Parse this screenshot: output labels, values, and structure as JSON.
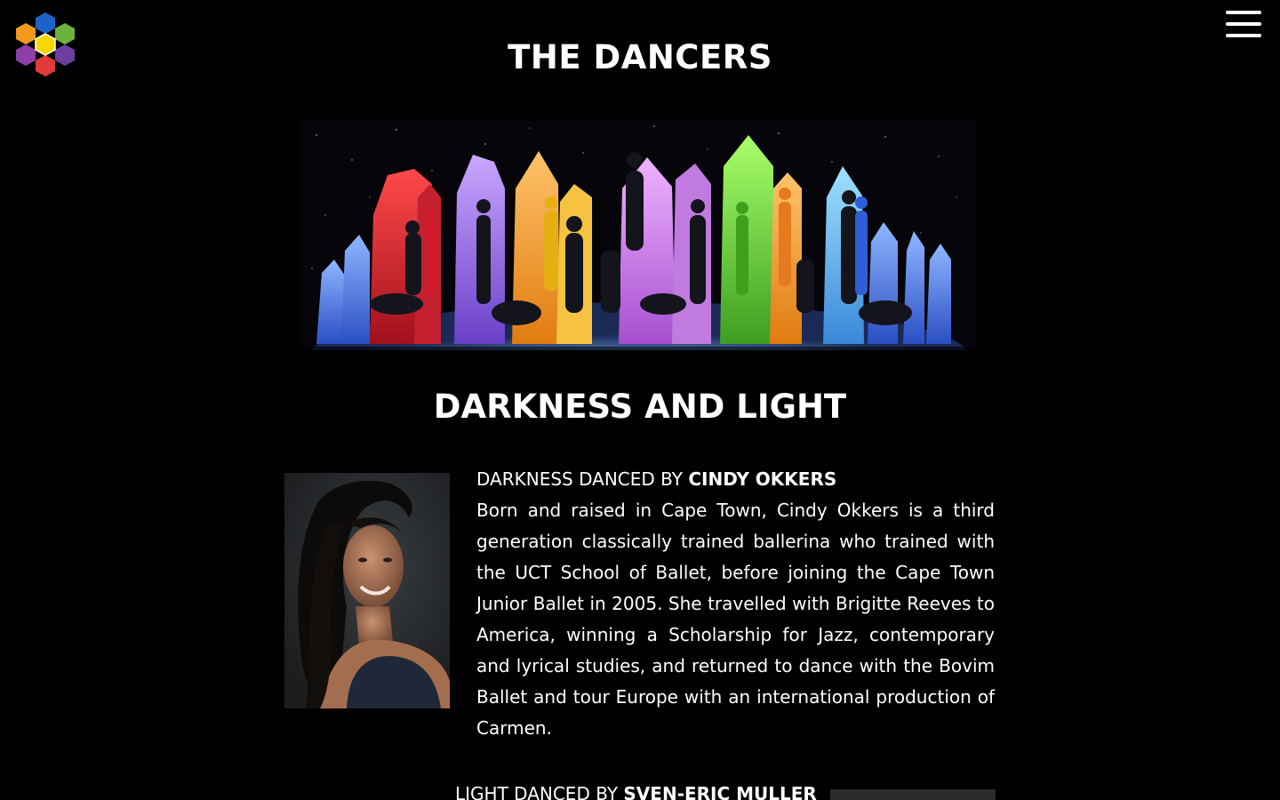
{
  "header": {
    "title": "THE DANCERS",
    "logo_icon": "hexagon-flower-logo-icon",
    "menu_icon": "hamburger-menu-icon"
  },
  "colors": {
    "background": "#000000",
    "text": "#ffffff",
    "logo_petals": [
      "#1e62c8",
      "#6bb43c",
      "#6a3fa0",
      "#e03a3a",
      "#8e3fa8",
      "#f39a1e",
      "#f5d800"
    ]
  },
  "hero": {
    "image_alt": "Dancers posed among rainbow-coloured crystal shapes"
  },
  "section": {
    "title": "DARKNESS AND LIGHT"
  },
  "dancers": [
    {
      "role_prefix": "DARKNESS DANCED BY ",
      "name": "CINDY OKKERS",
      "bio": "Born and raised in Cape Town, Cindy Okkers is a third generation classically trained ballerina who trained with the UCT School of Ballet, before joining the Cape Town Junior Ballet in 2005. She travelled with Brigitte Reeves to America, winning a Scholarship for Jazz, contemporary and lyrical studies, and returned to dance with the Bovim Ballet and tour Europe with an international production of Carmen."
    },
    {
      "role_prefix": "LIGHT DANCED BY ",
      "name": "SVEN-ERIC MULLER"
    }
  ]
}
